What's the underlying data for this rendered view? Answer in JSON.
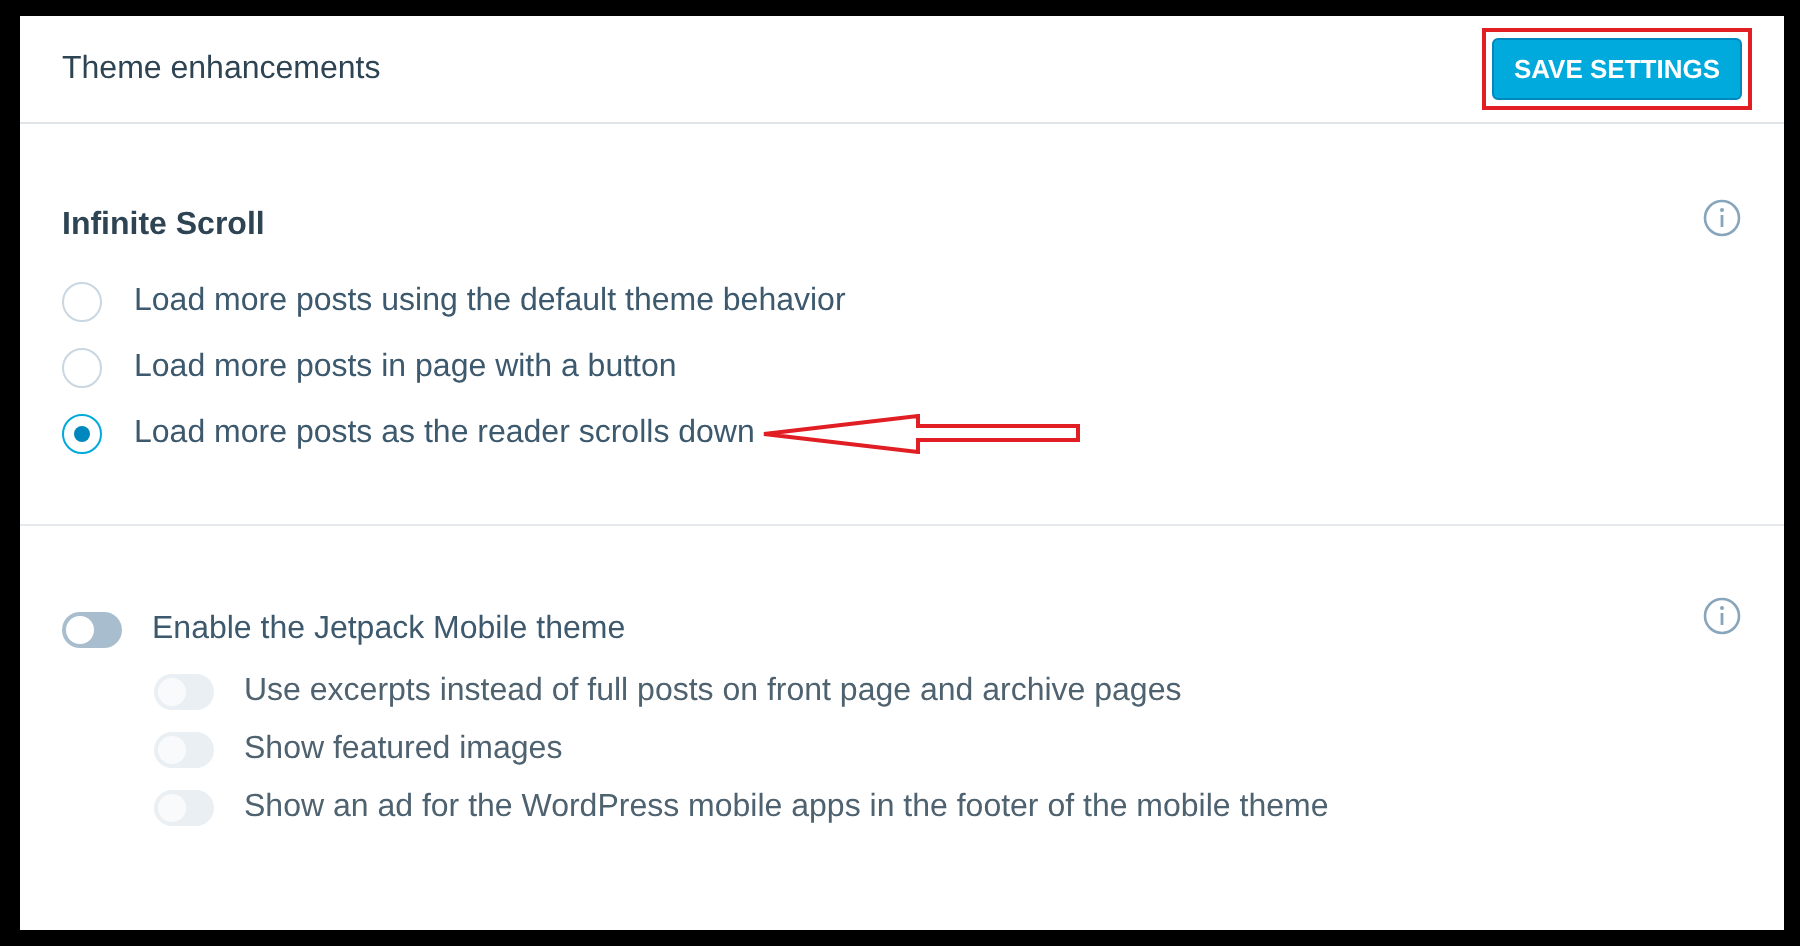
{
  "header": {
    "title": "Theme enhancements",
    "save_button": "SAVE SETTINGS",
    "button_highlighted": true
  },
  "infinite_scroll": {
    "heading": "Infinite Scroll",
    "options": [
      {
        "label": "Load more posts using the default theme behavior",
        "selected": false,
        "pointed": false
      },
      {
        "label": "Load more posts in page with a button",
        "selected": false,
        "pointed": false
      },
      {
        "label": "Load more posts as the reader scrolls down",
        "selected": true,
        "pointed": true
      }
    ]
  },
  "mobile_theme": {
    "label": "Enable the Jetpack Mobile theme",
    "on": false,
    "sub_options": [
      {
        "label": "Use excerpts instead of full posts on front page and archive pages",
        "on": false,
        "disabled": true
      },
      {
        "label": "Show featured images",
        "on": false,
        "disabled": true
      },
      {
        "label": "Show an ad for the WordPress mobile apps in the footer of the mobile theme",
        "on": false,
        "disabled": true
      }
    ]
  }
}
